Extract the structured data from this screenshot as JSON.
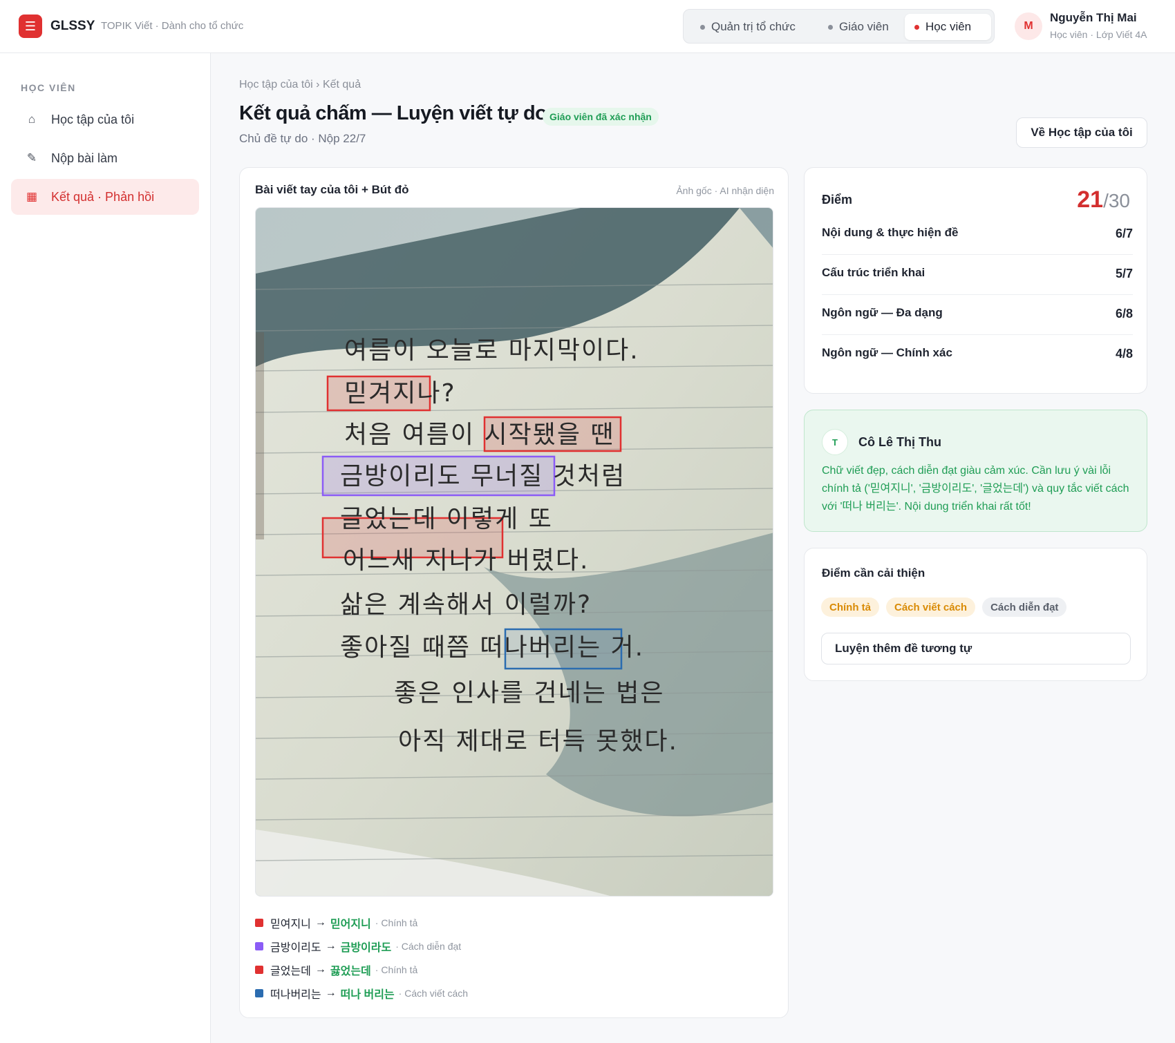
{
  "app": {
    "logo_glyph": "☰",
    "brand": "GLSSY",
    "brand_sub": "TOPIK Viết · Dành cho tổ chức",
    "accent": "#e03131"
  },
  "roles": [
    {
      "label": "Quản trị tổ chức",
      "active": false
    },
    {
      "label": "Giáo viên",
      "active": false
    },
    {
      "label": "Học viên",
      "active": true
    }
  ],
  "user": {
    "initial": "M",
    "name": "Nguyễn Thị Mai",
    "role": "Học viên · Lớp Viết 4A"
  },
  "sidebar": {
    "heading": "HỌC VIÊN",
    "items": [
      {
        "label": "Học tập của tôi",
        "icon": "home-icon",
        "active": false
      },
      {
        "label": "Nộp bài làm",
        "icon": "pen-icon",
        "active": false
      },
      {
        "label": "Kết quả · Phản hồi",
        "icon": "chart-icon",
        "active": true
      }
    ]
  },
  "page": {
    "breadcrumb": "Học tập của tôi › Kết quả",
    "title": "Kết quả chấm — Luyện viết tự do",
    "badge": "Giáo viên đã xác nhận",
    "subtitle": "Chủ đề tự do · Nộp 22/7",
    "back_button": "Về Học tập của tôi"
  },
  "essay": {
    "title": "Bài viết tay của tôi + Bút đỏ",
    "meta": "Ảnh gốc · AI nhận diện",
    "lines": [
      "여름이 오늘로 마지막이다.",
      "믿겨지나?",
      "처음 여름이 시작됐을 땐",
      "금방이리도 무너질 것처럼",
      "글었는데 이렇게 또",
      "어느새 지나가 버렸다.",
      "삶은 계속해서 이럴까?",
      "좋아질 때쯤 떠나버리는 거.",
      "좋은 인사를 건네는 법은",
      "아직 제대로 터득 못했다."
    ],
    "corrections": [
      {
        "original": "믿여지니",
        "fix": "믿어지니",
        "category": "Chính tả",
        "color": "#e03131"
      },
      {
        "original": "금방이리도",
        "fix": "금방이라도",
        "category": "Cách diễn đạt",
        "color": "#8b5cf6"
      },
      {
        "original": "글었는데",
        "fix": "끓었는데",
        "category": "Chính tả",
        "color": "#e03131"
      },
      {
        "original": "떠나버리는",
        "fix": "떠나 버리는",
        "category": "Cách viết cách",
        "color": "#2b6cb0"
      }
    ]
  },
  "score": {
    "heading": "Điểm",
    "total": "21",
    "max": "/30",
    "criteria": [
      {
        "name": "Nội dung & thực hiện đề",
        "value": "6/7"
      },
      {
        "name": "Cấu trúc triển khai",
        "value": "5/7"
      },
      {
        "name": "Ngôn ngữ — Đa dạng",
        "value": "6/8"
      },
      {
        "name": "Ngôn ngữ — Chính xác",
        "value": "4/8"
      }
    ]
  },
  "teacher": {
    "initial": "T",
    "name": "Cô Lê Thị Thu",
    "comment": "Chữ viết đẹp, cách diễn đạt giàu cảm xúc. Cần lưu ý vài lỗi chính tả ('믿여지니', '금방이리도', '글었는데') và quy tắc viết cách với '떠나 버리는'. Nội dung triển khai rất tốt!"
  },
  "improve": {
    "heading": "Điểm cần cải thiện",
    "tags": [
      "Chính tả",
      "Cách viết cách",
      "Cách diễn đạt"
    ],
    "practice_button": "Luyện thêm đề tương tự"
  }
}
